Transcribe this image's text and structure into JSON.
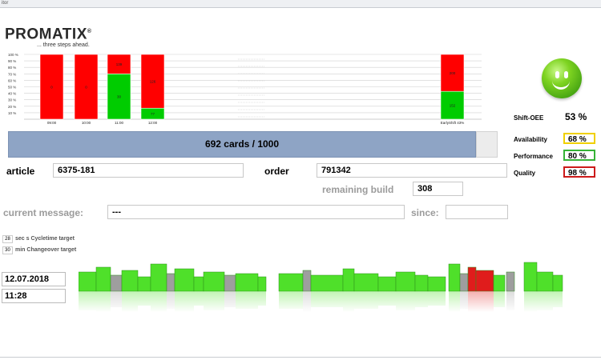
{
  "window": {
    "title": "itor"
  },
  "logo": {
    "name": "PROMATIX",
    "registered": "®",
    "tagline": "... three steps ahead."
  },
  "chart_data": {
    "type": "bar",
    "yticks": [
      "100 %",
      "90 %",
      "80 %",
      "70 %",
      "60 %",
      "50 %",
      "40 %",
      "30 %",
      "20 %",
      "10 %"
    ],
    "ylim": [
      0,
      100
    ],
    "categories": [
      "09:00",
      "10:00",
      "11:00",
      "12:00",
      "EarlyShift 43%"
    ],
    "series": [
      {
        "color": "#00cc00",
        "values": [
          0,
          0,
          70,
          17,
          43
        ],
        "labels": [
          "",
          "",
          "30",
          "77",
          "152"
        ]
      },
      {
        "color": "#ff0000",
        "values": [
          100,
          100,
          30,
          83,
          57
        ],
        "labels": [
          "0",
          "0",
          "139",
          "126",
          "200"
        ]
      }
    ]
  },
  "kpi": {
    "shift_oee": {
      "label": "Shift-OEE",
      "value": "53 %"
    },
    "availability": {
      "label": "Availability",
      "value": "68 %",
      "color": "#f0d000"
    },
    "performance": {
      "label": "Performance",
      "value": "80 %",
      "color": "#36b236"
    },
    "quality": {
      "label": "Quality",
      "value": "98 %",
      "color": "#cc1a1a"
    }
  },
  "progress": {
    "text": "692 cards / 1000",
    "fraction": 0.956
  },
  "article": {
    "label": "article",
    "value": "6375-181"
  },
  "order": {
    "label": "order",
    "value": "791342"
  },
  "remaining": {
    "label": "remaining build",
    "value": "308"
  },
  "message": {
    "label": "current message:",
    "value": "---",
    "since_label": "since:",
    "since_value": ""
  },
  "targets": {
    "cycle": {
      "value": "28",
      "label": "sec s Cycletime target"
    },
    "changeover": {
      "value": "30",
      "label": "min Changeover target"
    }
  },
  "date": "12.07.2018",
  "time": "11:28",
  "production_line": {
    "colors": {
      "ok": "#4fe02a",
      "alarm": "#e01c1c",
      "idle": "#9e9e9e"
    }
  }
}
